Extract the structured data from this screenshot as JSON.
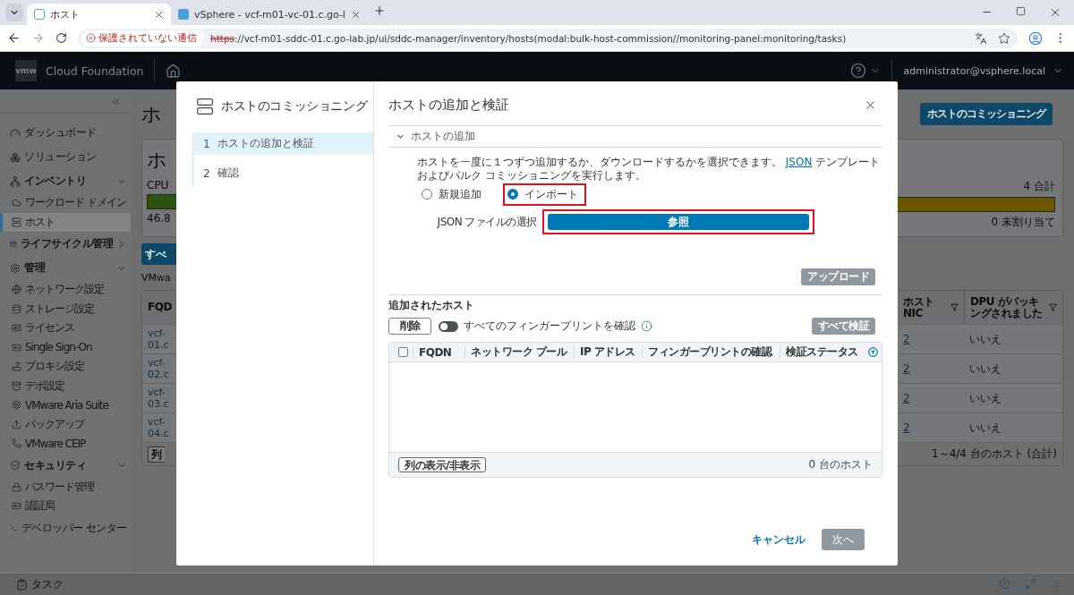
{
  "browser": {
    "tabs": [
      {
        "title": "ホスト",
        "selected": true
      },
      {
        "title": "vSphere - vcf-m01-vc-01.c.go-l",
        "selected": false
      }
    ],
    "security_chip": "保護されていない通信",
    "url_scheme": "https",
    "url_rest": "://vcf-m01-sddc-01.c.go-lab.jp/ui/sddc-manager/inventory/hosts(modal:bulk-host-commission//monitoring-panel:monitoring/tasks)"
  },
  "header": {
    "logo": "vmw",
    "product": "Cloud Foundation",
    "user": "administrator@vsphere.local"
  },
  "sidebar": {
    "items": [
      {
        "kind": "link",
        "label": "ダッシュボード",
        "selected": false
      },
      {
        "kind": "link",
        "label": "ソリューション",
        "selected": false
      },
      {
        "kind": "group",
        "label": "インベントリ",
        "expanded": true,
        "children": [
          {
            "label": "ワークロード ドメイン",
            "selected": false
          },
          {
            "label": "ホスト",
            "selected": true
          }
        ]
      },
      {
        "kind": "group",
        "label": "ライフサイクル管理",
        "expanded": false
      },
      {
        "kind": "group",
        "label": "管理",
        "expanded": true,
        "children": [
          {
            "label": "ネットワーク設定",
            "selected": false
          },
          {
            "label": "ストレージ設定",
            "selected": false
          },
          {
            "label": "ライセンス",
            "selected": false
          },
          {
            "label": "Single Sign-On",
            "selected": false
          },
          {
            "label": "プロキシ設定",
            "selected": false
          },
          {
            "label": "デポ設定",
            "selected": false
          },
          {
            "label": "VMware Aria Suite",
            "selected": false
          },
          {
            "label": "バックアップ",
            "selected": false
          },
          {
            "label": "VMware CEIP",
            "selected": false
          }
        ]
      },
      {
        "kind": "group",
        "label": "セキュリティ",
        "expanded": true,
        "children": [
          {
            "label": "パスワード管理",
            "selected": false
          },
          {
            "label": "認証局",
            "selected": false
          }
        ]
      },
      {
        "kind": "link",
        "label": "デベロッパー センター",
        "selected": false
      }
    ]
  },
  "page": {
    "title": "ホ",
    "commission_button": "ホストのコミッショニング",
    "summary": {
      "title": "ホ",
      "metric": "CPU",
      "used": "46.8",
      "total": "4 合計",
      "unassigned": "0 未割り当て"
    },
    "all_button": "すべ",
    "subtitle": "VMwa",
    "table": {
      "columns": [
        {
          "label": "FQD",
          "kind": "link",
          "filter": false
        },
        {
          "label": "ホスト NIC",
          "kind": "link",
          "filter": true
        },
        {
          "label": "DPU がパッキングされました",
          "kind": "text",
          "filter": true
        }
      ],
      "rows": [
        {
          "cells": [
            "vcf-01.c",
            "2",
            "いいえ"
          ]
        },
        {
          "cells": [
            "vcf-02.c",
            "2",
            "いいえ"
          ]
        },
        {
          "cells": [
            "vcf-03.c",
            "2",
            "いいえ"
          ]
        },
        {
          "cells": [
            "vcf-04.c",
            "2",
            "いいえ"
          ]
        }
      ],
      "columns_button": "列",
      "footer": "1～4/4 台のホスト (合計)"
    }
  },
  "modal": {
    "title": "ホストのコミッショニング",
    "steps": [
      {
        "number": "1",
        "label": "ホストの追加と検証",
        "selected": true
      },
      {
        "number": "2",
        "label": "確認",
        "selected": false
      }
    ],
    "panel_title": "ホストの追加と検証",
    "section": {
      "title": "ホストの追加",
      "expanded": true
    },
    "description": {
      "before": "ホストを一度に１つずつ追加するか、ダウンロードするかを選択できます。",
      "link": "JSON",
      "after": "テンプレートおよびバルク コミッショニングを実行します。"
    },
    "options": [
      {
        "label": "新規追加",
        "selected": false,
        "highlighted": false
      },
      {
        "label": "インポート",
        "selected": true,
        "highlighted": true
      }
    ],
    "file_label": "JSON ファイルの選択",
    "browse_button": {
      "label": "参照",
      "highlighted": true
    },
    "upload_button": {
      "label": "アップロード",
      "disabled": true
    },
    "added_title": "追加されたホスト",
    "delete_button": "削除",
    "fingerprint_toggle": {
      "label": "すべてのフィンガープリントを確認",
      "on": false
    },
    "validate_button": {
      "label": "すべて検証",
      "disabled": true
    },
    "table": {
      "select_all": false,
      "columns": [
        {
          "label": "FQDN",
          "filter": false
        },
        {
          "label": "ネットワーク プール",
          "filter": false
        },
        {
          "label": "IP アドレス",
          "filter": false
        },
        {
          "label": "フィンガープリントの確認",
          "filter": false
        },
        {
          "label": "検証ステータス",
          "filter": true
        }
      ],
      "columns_button": "列の表示/非表示",
      "footer": "0 台のホスト"
    },
    "cancel_button": "キャンセル",
    "next_button": {
      "label": "次へ",
      "disabled": true
    }
  },
  "taskbar": {
    "label": "タスク"
  }
}
